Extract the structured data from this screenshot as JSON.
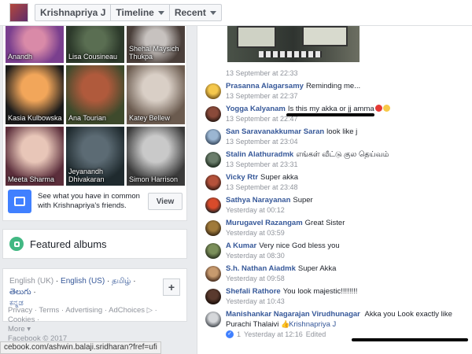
{
  "topbar": {
    "name": "Krishnapriya J",
    "timeline": "Timeline",
    "recent": "Recent"
  },
  "friends": [
    {
      "name": "Anandh",
      "colors": [
        "#d98aa8",
        "#7a3f8e"
      ]
    },
    {
      "name": "Lisa Cousineau",
      "colors": [
        "#5a6e52",
        "#2d3a2b"
      ]
    },
    {
      "name": "Shehal Maysich Thukpa",
      "colors": [
        "#c7c2bf",
        "#4a3f3a"
      ]
    },
    {
      "name": "Kasia Kulbowska",
      "colors": [
        "#f2a65a",
        "#1b1b1b"
      ]
    },
    {
      "name": "Ana Tourian",
      "colors": [
        "#b05a3c",
        "#3e4a2c"
      ]
    },
    {
      "name": "Katey Bellew",
      "colors": [
        "#d9cfc6",
        "#6b5b4f"
      ]
    },
    {
      "name": "Meeta Sharma",
      "colors": [
        "#e8c6b8",
        "#5b2e3b"
      ]
    },
    {
      "name": "Jeyanandh Dhivakaran",
      "colors": [
        "#5c6b74",
        "#1f2a2e"
      ]
    },
    {
      "name": "Simon Harrison",
      "colors": [
        "#c9c9c9",
        "#3a3a3a"
      ]
    }
  ],
  "common": {
    "text": "See what you have in common with Krishnapriya's friends.",
    "button": "View"
  },
  "albums": {
    "title": "Featured albums"
  },
  "languages": {
    "current": "English (UK)",
    "links": [
      "English (US)",
      "தமிழ்",
      "తెలుగు",
      "ಕನ್ನಡ"
    ],
    "add_label": "+"
  },
  "footer": {
    "links_line1": "Privacy · Terms · Advertising · AdChoices ▷ · Cookies ·",
    "links_line2": "More ▾",
    "copyright": "Facebook © 2017"
  },
  "post": {
    "timestamp": "13 September at 22:33"
  },
  "comments": [
    {
      "author": "Prasanna Alagarsamy",
      "text": "Reminding me...",
      "time": "13 September at 22:37",
      "avatar": [
        "#f5c84c",
        "#7a5a1d"
      ]
    },
    {
      "author": "Yogga Kalyanam",
      "text": "Is this my akka or jj amma",
      "time": "13 September at 22:47",
      "avatar": [
        "#8a4a3a",
        "#2c1a14"
      ]
    },
    {
      "author": "San Saravanakkumar Saran",
      "text": "look like j",
      "time": "13 September at 23:04",
      "avatar": [
        "#9bb6d2",
        "#3b4d63"
      ]
    },
    {
      "author": "Stalin Alathuradmk",
      "text": "எங்கள் வீட்டு குல தெய்வம்",
      "time": "13 September at 23:31",
      "avatar": [
        "#6a7d6b",
        "#1d2b1e"
      ]
    },
    {
      "author": "Vicky Rtr",
      "text": "Super akka",
      "time": "13 September at 23:48",
      "avatar": [
        "#b5523b",
        "#3a1d15"
      ]
    },
    {
      "author": "Sathya Narayanan",
      "text": "Super",
      "time": "Yesterday at 00:12",
      "avatar": [
        "#d94b2b",
        "#222222"
      ]
    },
    {
      "author": "Murugavel Razangam",
      "text": "Great Sister",
      "time": "Yesterday at 03:59",
      "avatar": [
        "#a07a3a",
        "#3b2a14"
      ]
    },
    {
      "author": "A Kumar",
      "text": "Very nice God bless you",
      "time": "Yesterday at 08:30",
      "avatar": [
        "#7b8f5a",
        "#2c3420"
      ]
    },
    {
      "author": "S.h. Nathan Aiadmk",
      "text": "Super Akka",
      "time": "Yesterday at 09:58",
      "avatar": [
        "#c79a6e",
        "#4a3020"
      ]
    },
    {
      "author": "Shefali Rathore",
      "text": "You look majestic!!!!!!!!",
      "time": "Yesterday at 10:43",
      "avatar": [
        "#5a3a2e",
        "#1a0f0a"
      ]
    }
  ],
  "last_comment": {
    "author": "Manishankar Nagarajan Virudhunagar",
    "text": "Akka you Look exactly like Purachi Thalaivi",
    "mention": "Krishnapriya J",
    "like_count": "1",
    "time": "Yesterday at 12:16",
    "edited": "Edited",
    "avatar": [
      "#d5d7da",
      "#4a4f55"
    ]
  },
  "statusbar": {
    "url": "cebook.com/ashwin.balaji.sridharan?fref=ufi"
  }
}
